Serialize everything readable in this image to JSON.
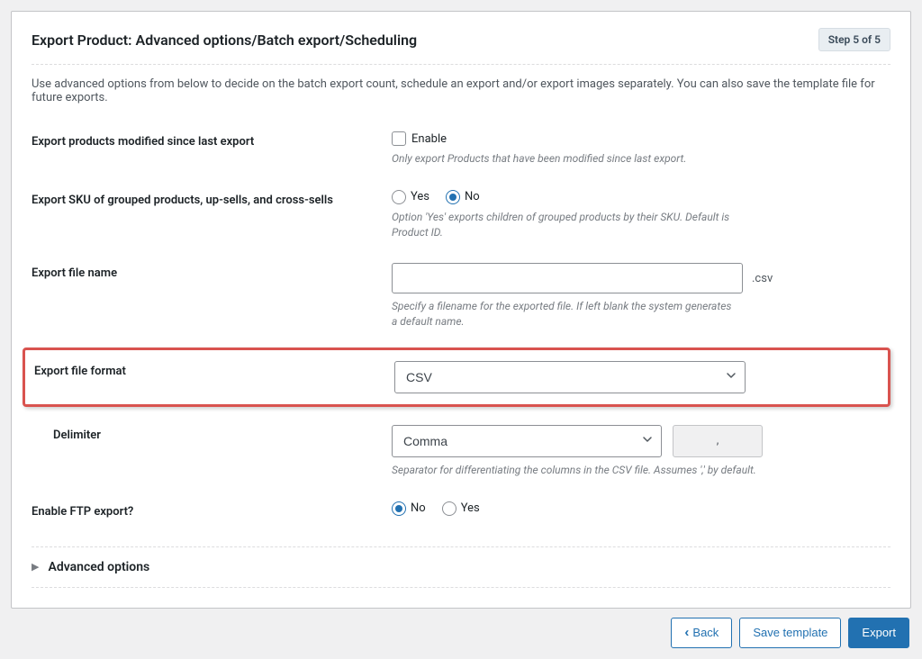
{
  "header": {
    "title": "Export Product: Advanced options/Batch export/Scheduling",
    "step_badge": "Step 5 of 5"
  },
  "intro": "Use advanced options from below to decide on the batch export count, schedule an export and/or export images separately. You can also save the template file for future exports.",
  "fields": {
    "modified_since": {
      "label": "Export products modified since last export",
      "checkbox_label": "Enable",
      "help": "Only export Products that have been modified since last export."
    },
    "sku_grouped": {
      "label": "Export SKU of grouped products, up-sells, and cross-sells",
      "yes": "Yes",
      "no": "No",
      "help": "Option 'Yes' exports children of grouped products by their SKU. Default is Product ID."
    },
    "file_name": {
      "label": "Export file name",
      "suffix": ".csv",
      "help": "Specify a filename for the exported file. If left blank the system generates a default name."
    },
    "file_format": {
      "label": "Export file format",
      "value": "CSV"
    },
    "delimiter": {
      "label": "Delimiter",
      "value": "Comma",
      "char": ",",
      "help": "Separator for differentiating the columns in the CSV file. Assumes ',' by default."
    },
    "ftp": {
      "label": "Enable FTP export?",
      "no": "No",
      "yes": "Yes"
    }
  },
  "advanced": {
    "title": "Advanced options"
  },
  "footer": {
    "back": "Back",
    "save_template": "Save template",
    "export": "Export"
  }
}
